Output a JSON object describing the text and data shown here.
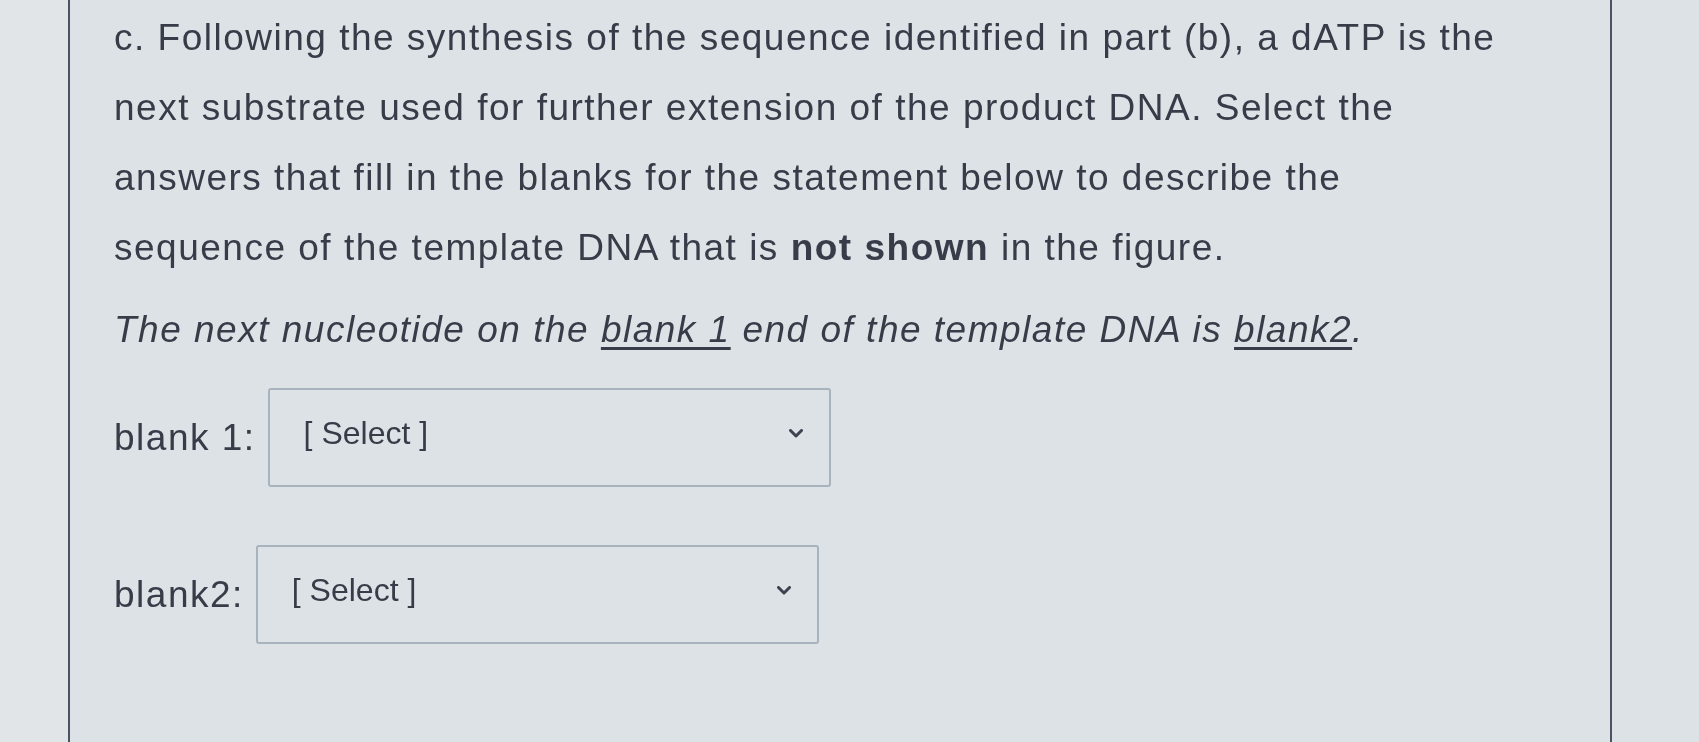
{
  "question": {
    "text": "c. Following the synthesis of the sequence identified in part (b), a dATP is the next substrate used for further extension of the product DNA. Select the answers that fill in the blanks for the statement below to describe the sequence of the template DNA that is **not shown** in the figure."
  },
  "statement": [
    {
      "kind": "text",
      "text": "The next nucleotide on the "
    },
    {
      "kind": "blank",
      "text": "blank 1"
    },
    {
      "kind": "text",
      "text": " end of the template DNA is "
    },
    {
      "kind": "blank",
      "text": "blank2"
    },
    {
      "kind": "text",
      "text": "."
    }
  ],
  "dropdowns": [
    {
      "label": "blank 1:",
      "value": "[ Select ]"
    },
    {
      "label": "blank2:",
      "value": "[ Select ]"
    }
  ]
}
